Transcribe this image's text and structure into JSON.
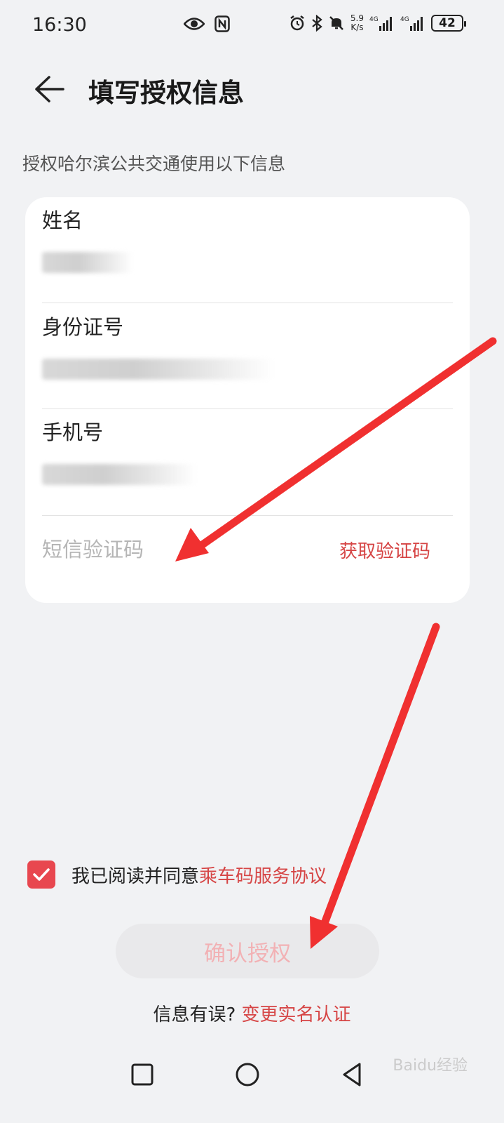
{
  "status_bar": {
    "time": "16:30",
    "net_speed_value": "5.9",
    "net_speed_unit": "K/s",
    "sim1": "4G",
    "sim2": "4G",
    "battery": "42",
    "icons": [
      "eye-icon",
      "nfc-icon",
      "alarm-icon",
      "bluetooth-icon",
      "mute-icon",
      "signal-icon",
      "battery-icon"
    ]
  },
  "header": {
    "title": "填写授权信息"
  },
  "subtitle": "授权哈尔滨公共交通使用以下信息",
  "form": {
    "name_label": "姓名",
    "id_label": "身份证号",
    "phone_label": "手机号",
    "sms_placeholder": "短信验证码",
    "get_code_label": "获取验证码"
  },
  "agreement": {
    "checked": true,
    "text": "我已阅读并同意",
    "link": "乘车码服务协议"
  },
  "confirm_label": "确认授权",
  "error": {
    "question": "信息有误?",
    "link": "变更实名认证"
  },
  "watermark": "Baidu经验",
  "colors": {
    "accent": "#d64545",
    "checkbox": "#e8474f",
    "background": "#f1f2f4",
    "arrow": "#f03030"
  }
}
